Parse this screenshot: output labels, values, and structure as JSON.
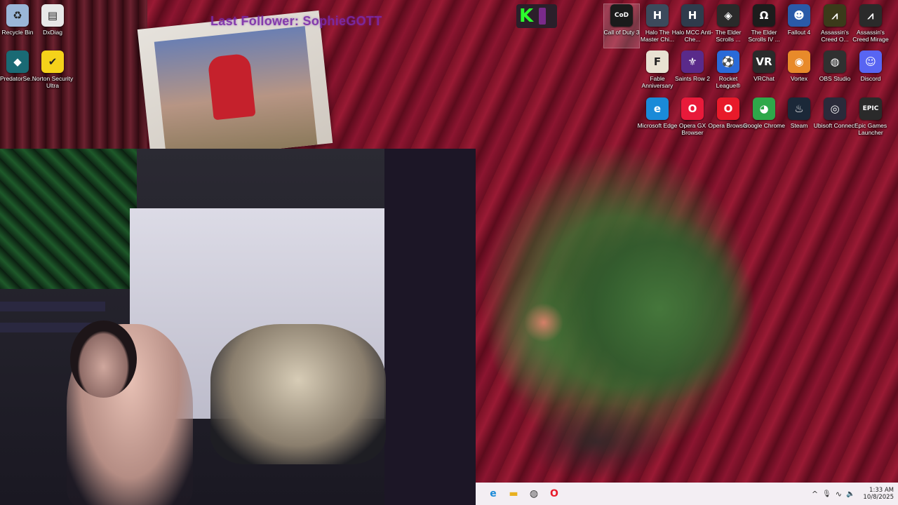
{
  "overlay": {
    "text": "Last Follower: SophieGOTT",
    "badge_letter": "K"
  },
  "desktop": {
    "left_icons": [
      {
        "label": "Recycle Bin",
        "icon": "recycle-bin-icon",
        "glyph": "♻",
        "color": "#9bb6d8"
      },
      {
        "label": "DxDiag",
        "icon": "document-icon",
        "glyph": "▤",
        "color": "#e8e8e8"
      },
      {
        "label": "PredatorSe...",
        "icon": "predator-sense-icon",
        "glyph": "◆",
        "color": "#1a6a74"
      },
      {
        "label": "Norton Security Ultra",
        "icon": "norton-icon",
        "glyph": "✔",
        "color": "#f5d21a"
      }
    ],
    "grid_icons": [
      {
        "label": "Call of Duty 3",
        "icon": "call-of-duty-icon",
        "glyph": "CoD",
        "color": "#1b1b1b"
      },
      {
        "label": "Halo The Master Chi...",
        "icon": "halo-icon",
        "glyph": "H",
        "color": "#3c4a5c"
      },
      {
        "label": "Halo MCC Anti-Che...",
        "icon": "halo-mcc-icon",
        "glyph": "H",
        "color": "#2f3b4c"
      },
      {
        "label": "The Elder Scrolls ...",
        "icon": "elder-scrolls-icon",
        "glyph": "◈",
        "color": "#2a2a2a"
      },
      {
        "label": "The Elder Scrolls IV ...",
        "icon": "oblivion-icon",
        "glyph": "Ω",
        "color": "#1c1c1c"
      },
      {
        "label": "Fallout 4",
        "icon": "fallout-icon",
        "glyph": "☻",
        "color": "#2a5aa8"
      },
      {
        "label": "Assassin's Creed O...",
        "icon": "assassins-creed-icon",
        "glyph": "⩘",
        "color": "#3b3a1a"
      },
      {
        "label": "Assassin's Creed Mirage",
        "icon": "assassins-creed-mirage-icon",
        "glyph": "⩘",
        "color": "#2a2a2a"
      },
      {
        "label": "Fable Anniversary",
        "icon": "fable-icon",
        "glyph": "F",
        "color": "#e8e1d2"
      },
      {
        "label": "Saints Row 2",
        "icon": "saints-row-icon",
        "glyph": "⚜",
        "color": "#5a2a8a"
      },
      {
        "label": "Rocket League®",
        "icon": "rocket-league-icon",
        "glyph": "⚽",
        "color": "#2a6ad8"
      },
      {
        "label": "VRChat",
        "icon": "vrchat-icon",
        "glyph": "VR",
        "color": "#2a2a2a"
      },
      {
        "label": "Vortex",
        "icon": "vortex-icon",
        "glyph": "◉",
        "color": "#e88a2a"
      },
      {
        "label": "OBS Studio",
        "icon": "obs-studio-icon",
        "glyph": "◍",
        "color": "#303030"
      },
      {
        "label": "Discord",
        "icon": "discord-icon",
        "glyph": "☺",
        "color": "#5865f2"
      },
      {
        "label": "Microsoft Edge",
        "icon": "edge-icon",
        "glyph": "e",
        "color": "#1a8ad8"
      },
      {
        "label": "Opera GX Browser",
        "icon": "opera-gx-icon",
        "glyph": "O",
        "color": "#e81a3a"
      },
      {
        "label": "Opera Browser",
        "icon": "opera-icon",
        "glyph": "O",
        "color": "#e81a2a"
      },
      {
        "label": "Google Chrome",
        "icon": "chrome-icon",
        "glyph": "◕",
        "color": "#2ea84a"
      },
      {
        "label": "Steam",
        "icon": "steam-icon",
        "glyph": "♨",
        "color": "#1b2838"
      },
      {
        "label": "Ubisoft Connect",
        "icon": "ubisoft-icon",
        "glyph": "◎",
        "color": "#2a2a3a"
      },
      {
        "label": "Epic Games Launcher",
        "icon": "epic-games-icon",
        "glyph": "EPIC",
        "color": "#2a2a2a"
      }
    ]
  },
  "taskbar": {
    "apps": [
      {
        "name": "edge",
        "glyph": "e",
        "color": "#1a8ad8"
      },
      {
        "name": "file-explorer",
        "glyph": "▬",
        "color": "#e8b020"
      },
      {
        "name": "obs",
        "glyph": "◍",
        "color": "#333333"
      },
      {
        "name": "opera",
        "glyph": "O",
        "color": "#e81a2a"
      }
    ],
    "tray": {
      "chevron": "^",
      "mic": "🎙",
      "wifi": "∿",
      "volume": "🔈"
    },
    "time": "1:33 AM",
    "date": "10/8/2025"
  }
}
